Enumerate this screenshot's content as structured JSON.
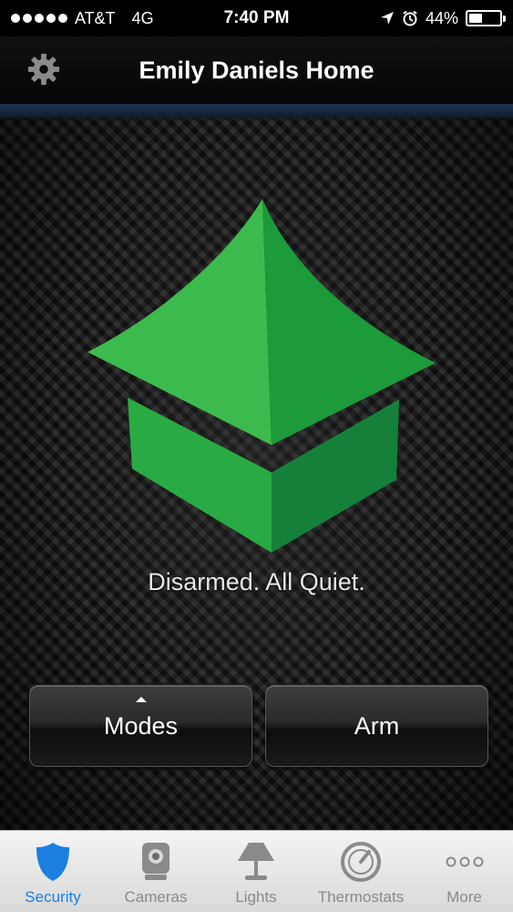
{
  "status_bar": {
    "carrier": "AT&T",
    "network": "4G",
    "time": "7:40 PM",
    "battery": "44%",
    "battery_level": 0.44
  },
  "nav": {
    "title": "Emily Daniels Home",
    "settings_icon": "gear-icon"
  },
  "security": {
    "status_message": "Disarmed. All Quiet.",
    "logo_color_light": "#3dba4d",
    "logo_color_dark": "#1d9a3a"
  },
  "buttons": {
    "modes_label": "Modes",
    "arm_label": "Arm"
  },
  "tabs": [
    {
      "label": "Security",
      "icon": "shield-icon",
      "active": true
    },
    {
      "label": "Cameras",
      "icon": "camera-icon",
      "active": false
    },
    {
      "label": "Lights",
      "icon": "lamp-icon",
      "active": false
    },
    {
      "label": "Thermostats",
      "icon": "thermostat-icon",
      "active": false
    },
    {
      "label": "More",
      "icon": "more-icon",
      "active": false
    }
  ],
  "colors": {
    "active_tab": "#1a7fe0",
    "inactive_tab": "#8a8a8a",
    "accent_bar": "#1e3550"
  }
}
